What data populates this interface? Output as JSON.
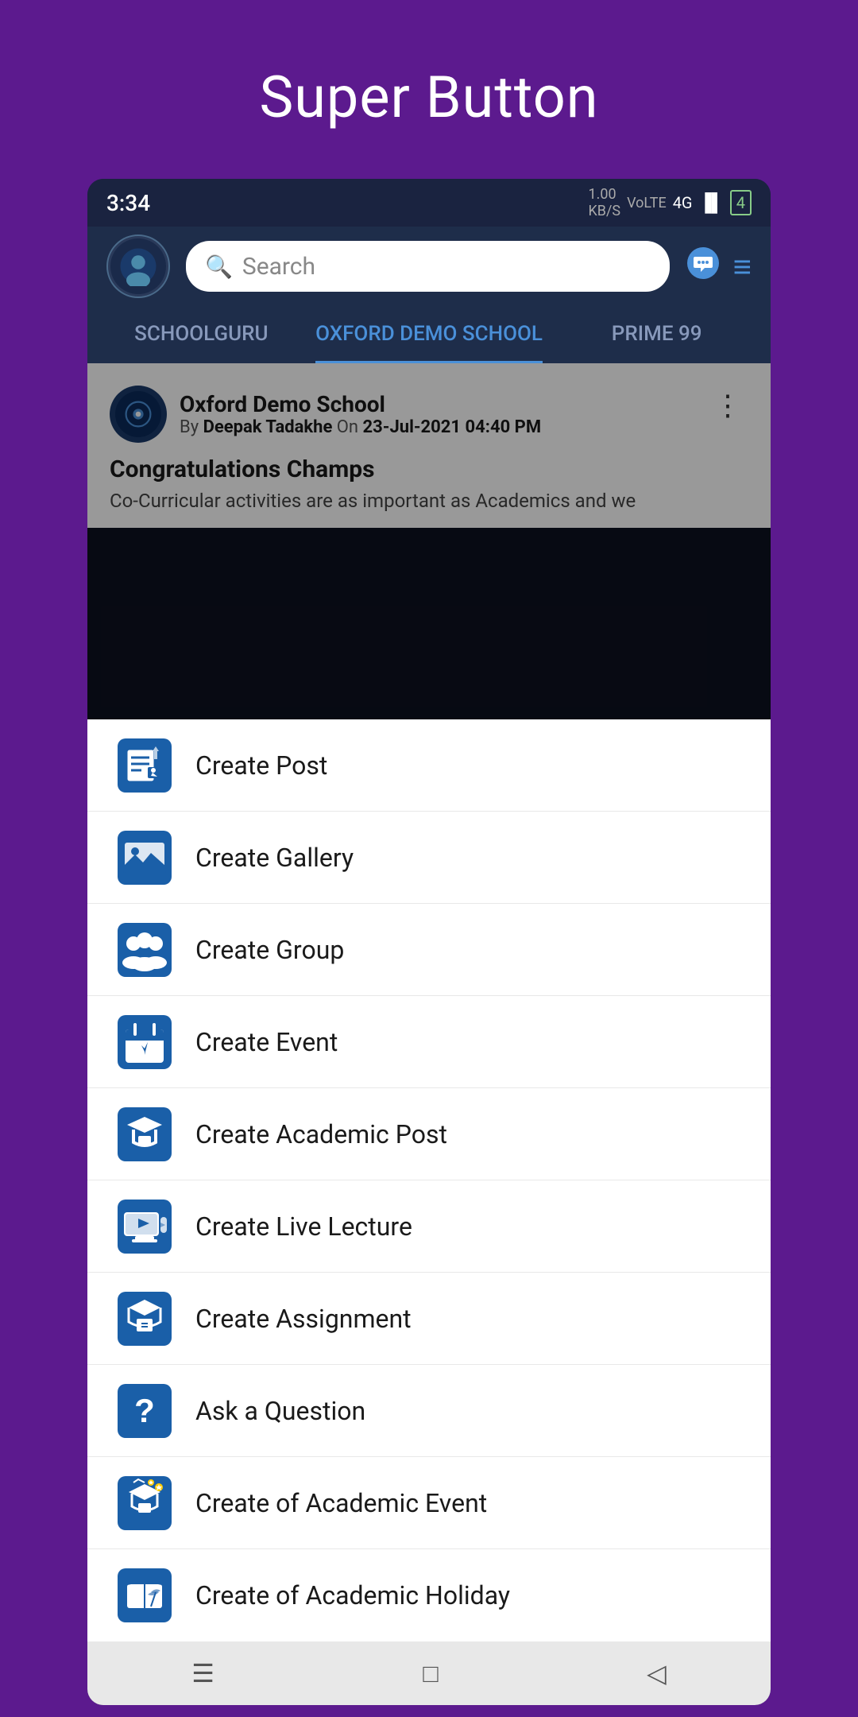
{
  "page": {
    "title": "Super Button"
  },
  "status_bar": {
    "time": "3:34",
    "data_speed": "1.00 KB/S",
    "network": "VoLTE",
    "signal": "4G"
  },
  "header": {
    "search_placeholder": "Search",
    "chat_icon": "💬",
    "menu_icon": "☰"
  },
  "tabs": [
    {
      "label": "SCHOOLGURU",
      "active": false
    },
    {
      "label": "OXFORD DEMO SCHOOL",
      "active": true
    },
    {
      "label": "PRIME 99",
      "active": false
    }
  ],
  "post": {
    "school_name": "Oxford Demo School",
    "by_prefix": "By ",
    "author": "Deepak Tadakhe",
    "on_text": " On ",
    "date": "23-Jul-2021 04:40 PM",
    "title": "Congratulations Champs",
    "excerpt": "Co-Curricular activities are as important as Academics and we"
  },
  "menu_items": [
    {
      "id": "create-post",
      "label": "Create Post",
      "icon": "post"
    },
    {
      "id": "create-gallery",
      "label": "Create Gallery",
      "icon": "gallery"
    },
    {
      "id": "create-group",
      "label": "Create Group",
      "icon": "group"
    },
    {
      "id": "create-event",
      "label": "Create Event",
      "icon": "event"
    },
    {
      "id": "create-academic-post",
      "label": "Create Academic Post",
      "icon": "academic-post"
    },
    {
      "id": "create-live-lecture",
      "label": "Create Live Lecture",
      "icon": "live-lecture"
    },
    {
      "id": "create-assignment",
      "label": "Create Assignment",
      "icon": "assignment"
    },
    {
      "id": "ask-question",
      "label": "Ask a Question",
      "icon": "question"
    },
    {
      "id": "create-academic-event",
      "label": "Create of Academic Event",
      "icon": "academic-event"
    },
    {
      "id": "create-academic-holiday",
      "label": "Create of Academic Holiday",
      "icon": "academic-holiday"
    }
  ],
  "nav_bar": {
    "menu_icon": "☰",
    "home_icon": "□",
    "back_icon": "◁"
  }
}
